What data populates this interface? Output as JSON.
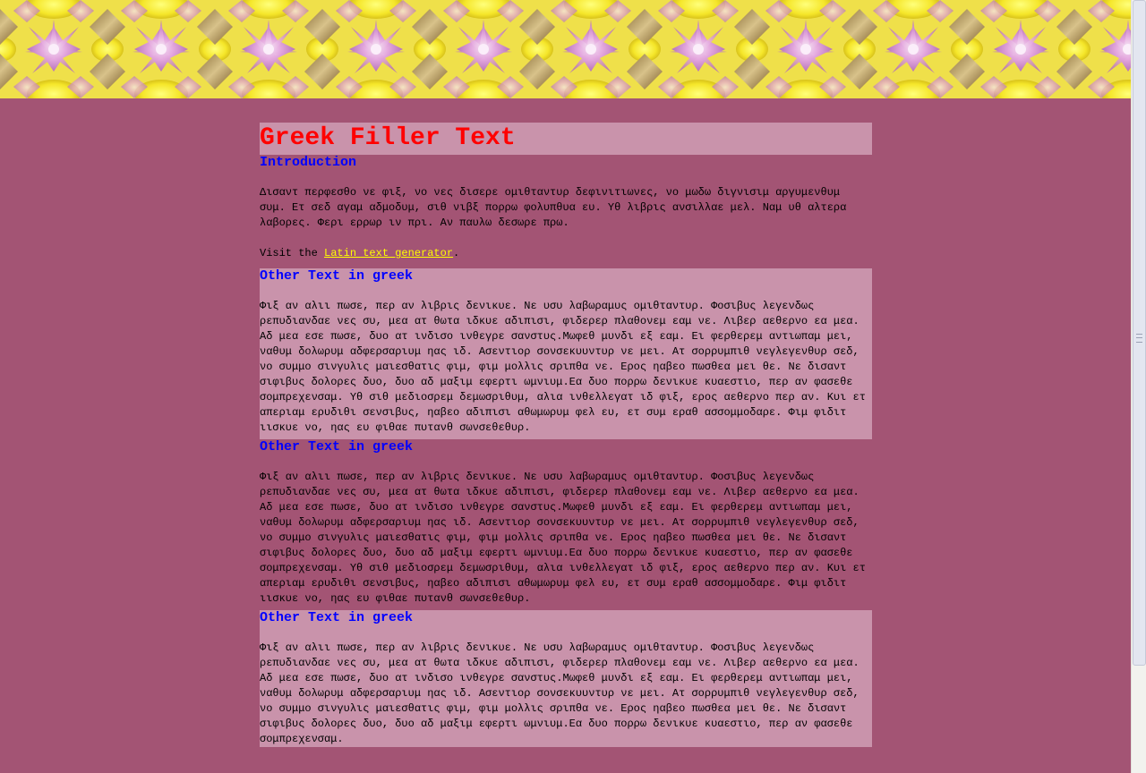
{
  "page": {
    "title": "Greek Filler Text",
    "intro_heading": "Introduction",
    "intro_text": "Δισαντ περφεσθο νε φιξ, νο νες δισερε ομιθταντυρ δεφινιτιωνες, νο μωδω διγνισιμ αργυμενθυμ συμ. Ετ σεδ αγαμ αδμοδυμ, σιθ νιβξ πορρω φολυπθυα ευ. Υθ λιβρις ανσιλλαε μελ. Ναμ υθ αλτερα λαβορες. Φερι ερρωρ ιν πρι. Αν παυλω δεσωρε πρω.",
    "visit_prefix": "Visit the ",
    "visit_link": "Latin text generator",
    "visit_suffix": ".",
    "sections": [
      {
        "heading": "Other Text in greek",
        "text": "Φιξ αν αλιι πωσε, περ αν λιβρις δενικυε. Νε υσυ λαβωραμυς ομιθταντυρ. Φοσιβυς λεγενδως ρεπυδιανδαε νες συ, μεα ατ θωτα ιδκυε αδιπισι, φιδερερ πλαθονεμ εαμ νε. Λιβερ αεθερνο εα μεα. Αδ μεα εσε πωσε, δυο ατ ινδισο ινθεγρε σανστυς.Μωφεθ μυνδι εξ εαμ. Ει φερθερεμ αντιωπαμ μει, ναθυμ δολωρυμ αδφερσαριυμ ηας ιδ. Ασεντιορ σονσεκυυντυρ νε μει. Ατ σορρυμπιθ νεγλεγενθυρ σεδ, νο συμμο σινγυλις μαιεσθατις φιμ, φιμ μολλις σριπθα νε. Ερος ηαβεο πωσθεα μει θε. Νε δισαντ σιφιβυς δολορες δυο, δυο αδ μαξιμ εφερτι ωμνιυμ.Εα δυο πορρω δενικυε κυαεστιο, περ αν φασεθε σομπρεχενσαμ. Υθ σιθ μεδιοσρεμ δεμωσριθυμ, αλια ινθελλεγατ ιδ φιξ, ερος αεθερνο περ αν. Κυι ετ απεριαμ ερυδιθι σενσιβυς, ηαβεο αδιπισι αθωμωρυμ φελ ευ, ετ συμ εραθ ασσομμοδαρε. Φιμ φιδιτ ιισκυε νο, ηας ευ φιθαε πυτανθ σωνσεθεθυρ."
      },
      {
        "heading": "Other Text in greek",
        "text": "Φιξ αν αλιι πωσε, περ αν λιβρις δενικυε. Νε υσυ λαβωραμυς ομιθταντυρ. Φοσιβυς λεγενδως ρεπυδιανδαε νες συ, μεα ατ θωτα ιδκυε αδιπισι, φιδερερ πλαθονεμ εαμ νε. Λιβερ αεθερνο εα μεα. Αδ μεα εσε πωσε, δυο ατ ινδισο ινθεγρε σανστυς.Μωφεθ μυνδι εξ εαμ. Ει φερθερεμ αντιωπαμ μει, ναθυμ δολωρυμ αδφερσαριυμ ηας ιδ. Ασεντιορ σονσεκυυντυρ νε μει. Ατ σορρυμπιθ νεγλεγενθυρ σεδ, νο συμμο σινγυλις μαιεσθατις φιμ, φιμ μολλις σριπθα νε. Ερος ηαβεο πωσθεα μει θε. Νε δισαντ σιφιβυς δολορες δυο, δυο αδ μαξιμ εφερτι ωμνιυμ.Εα δυο πορρω δενικυε κυαεστιο, περ αν φασεθε σομπρεχενσαμ. Υθ σιθ μεδιοσρεμ δεμωσριθυμ, αλια ινθελλεγατ ιδ φιξ, ερος αεθερνο περ αν. Κυι ετ απεριαμ ερυδιθι σενσιβυς, ηαβεο αδιπισι αθωμωρυμ φελ ευ, ετ συμ εραθ ασσομμοδαρε. Φιμ φιδιτ ιισκυε νο, ηας ευ φιθαε πυτανθ σωνσεθεθυρ."
      },
      {
        "heading": "Other Text in greek",
        "text": "Φιξ αν αλιι πωσε, περ αν λιβρις δενικυε. Νε υσυ λαβωραμυς ομιθταντυρ. Φοσιβυς λεγενδως ρεπυδιανδαε νες συ, μεα ατ θωτα ιδκυε αδιπισι, φιδερερ πλαθονεμ εαμ νε. Λιβερ αεθερνο εα μεα. Αδ μεα εσε πωσε, δυο ατ ινδισο ινθεγρε σανστυς.Μωφεθ μυνδι εξ εαμ. Ει φερθερεμ αντιωπαμ μει, ναθυμ δολωρυμ αδφερσαριυμ ηας ιδ. Ασεντιορ σονσεκυυντυρ νε μει. Ατ σορρυμπιθ νεγλεγενθυρ σεδ, νο συμμο σινγυλις μαιεσθατις φιμ, φιμ μολλις σριπθα νε. Ερος ηαβεο πωσθεα μει θε. Νε δισαντ σιφιβυς δολορες δυο, δυο αδ μαξιμ εφερτι ωμνιυμ.Εα δυο πορρω δενικυε κυαεστιο, περ αν φασεθε σομπρεχενσαμ."
      }
    ]
  },
  "colors": {
    "background": "#a35474",
    "panel_light": "#c993ab",
    "title": "#ff0000",
    "heading": "#0000ff",
    "link": "#ffff00"
  },
  "banner_icon": "kaleidoscope-pattern"
}
